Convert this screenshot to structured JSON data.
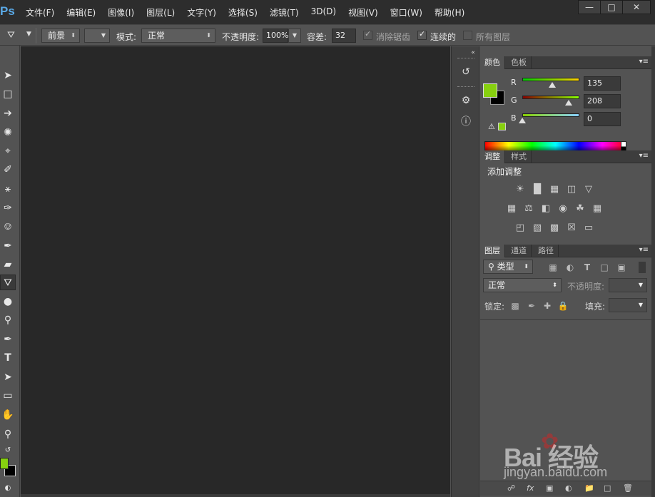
{
  "app": {
    "logo": "Ps"
  },
  "menu": [
    "文件(F)",
    "编辑(E)",
    "图像(I)",
    "图层(L)",
    "文字(Y)",
    "选择(S)",
    "滤镜(T)",
    "3D(D)",
    "视图(V)",
    "窗口(W)",
    "帮助(H)"
  ],
  "window_buttons": {
    "minimize": "—",
    "restore": "□",
    "close": "✕"
  },
  "options": {
    "fill_source": "前景",
    "mode_label": "模式:",
    "mode_value": "正常",
    "opacity_label": "不透明度:",
    "opacity_value": "100%",
    "tolerance_label": "容差:",
    "tolerance_value": "32",
    "antialias_label": "消除锯齿",
    "contiguous_label": "连续的",
    "all_layers_label": "所有图层"
  },
  "color_panel": {
    "tabs": [
      "颜色",
      "色板"
    ],
    "foreground": "#87d00f",
    "background": "#000000",
    "r_label": "R",
    "r_value": "135",
    "g_label": "G",
    "g_value": "208",
    "b_label": "B",
    "b_value": "0"
  },
  "adjust_panel": {
    "tabs": [
      "调整",
      "样式"
    ],
    "title": "添加调整"
  },
  "layers_panel": {
    "tabs": [
      "图层",
      "通道",
      "路径"
    ],
    "filter_label": "类型",
    "blend_mode": "正常",
    "opacity_label": "不透明度:",
    "lock_label": "锁定:",
    "fill_label": "填充:"
  },
  "watermark": {
    "brand": "Bai  经验",
    "url": "jingyan.baidu.com"
  }
}
